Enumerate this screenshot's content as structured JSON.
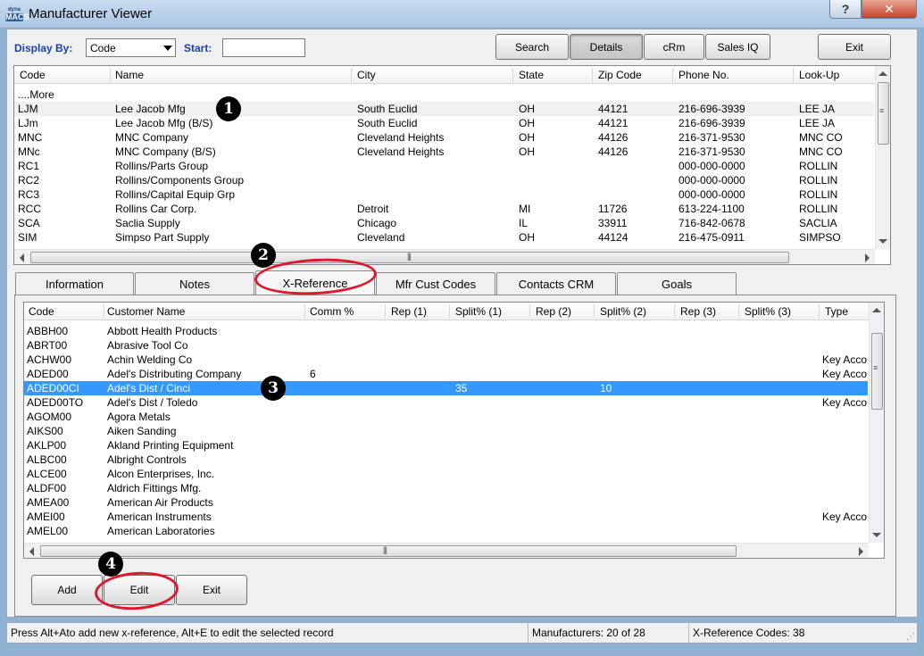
{
  "window": {
    "title": "Manufacturer Viewer",
    "app_logo_top": "dyna",
    "app_logo_main": "MACS",
    "help_glyph": "?",
    "close_glyph": "✕"
  },
  "toolbar": {
    "display_by_label": "Display By:",
    "display_by_value": "Code",
    "start_label": "Start:",
    "start_value": "",
    "search_label": "Search",
    "details_label": "Details",
    "crm_label": "cRm",
    "salesiq_label": "Sales IQ",
    "exit_label": "Exit"
  },
  "manufacturers": {
    "columns": [
      "Code",
      "Name",
      "City",
      "State",
      "Zip Code",
      "Phone No.",
      "Look-Up"
    ],
    "more_label": "....More",
    "rows": [
      [
        "LJM",
        "Lee Jacob Mfg",
        "South Euclid",
        "OH",
        "44121",
        "216-696-3939",
        "LEE JA"
      ],
      [
        "LJm",
        "Lee Jacob Mfg (B/S)",
        "South Euclid",
        "OH",
        "44121",
        "216-696-3939",
        "LEE JA"
      ],
      [
        "MNC",
        "MNC Company",
        "Cleveland Heights",
        "OH",
        "44126",
        "216-371-9530",
        "MNC CO"
      ],
      [
        "MNc",
        "MNC Company (B/S)",
        "Cleveland Heights",
        "OH",
        "44126",
        "216-371-9530",
        "MNC CO"
      ],
      [
        "RC1",
        "Rollins/Parts Group",
        "",
        "",
        "",
        "000-000-0000",
        "ROLLIN"
      ],
      [
        "RC2",
        "Rollins/Components Group",
        "",
        "",
        "",
        "000-000-0000",
        "ROLLIN"
      ],
      [
        "RC3",
        "Rollins/Capital Equip Grp",
        "",
        "",
        "",
        "000-000-0000",
        "ROLLIN"
      ],
      [
        "RCC",
        "Rollins Car Corp.",
        "Detroit",
        "MI",
        "11726",
        "613-224-1100",
        "ROLLIN"
      ],
      [
        "SCA",
        "Saclia Supply",
        "Chicago",
        "IL",
        "33911",
        "716-842-0678",
        "SACLIA"
      ],
      [
        "SIM",
        "Simpso Part Supply",
        "Cleveland",
        "OH",
        "44124",
        "216-475-0911",
        "SIMPSO"
      ]
    ]
  },
  "tabs": [
    "Information",
    "Notes",
    "X-Reference",
    "Mfr Cust Codes",
    "Contacts CRM",
    "Goals"
  ],
  "active_tab": "X-Reference",
  "xref": {
    "columns": [
      "Code",
      "Customer Name",
      "Comm %",
      "Rep (1)",
      "Split% (1)",
      "Rep (2)",
      "Split% (2)",
      "Rep (3)",
      "Split% (3)",
      "Type"
    ],
    "selected_index": 4,
    "rows": [
      [
        "ABBH00",
        "Abbott Health Products",
        "",
        "",
        "",
        "",
        "",
        "",
        "",
        ""
      ],
      [
        "ABRT00",
        "Abrasive Tool Co",
        "",
        "",
        "",
        "",
        "",
        "",
        "",
        ""
      ],
      [
        "ACHW00",
        "Achin Welding Co",
        "",
        "",
        "",
        "",
        "",
        "",
        "",
        "Key Acco"
      ],
      [
        "ADED00",
        "Adel's Distributing Company",
        "6",
        "",
        "",
        "",
        "",
        "",
        "",
        "Key Acco"
      ],
      [
        "ADED00CI",
        "Adel's Dist / Cinci",
        "",
        "",
        "35",
        "",
        "10",
        "",
        "",
        ""
      ],
      [
        "ADED00TO",
        "Adel's Dist / Toledo",
        "",
        "",
        "",
        "",
        "",
        "",
        "",
        "Key Acco"
      ],
      [
        "AGOM00",
        "Agora Metals",
        "",
        "",
        "",
        "",
        "",
        "",
        "",
        ""
      ],
      [
        "AIKS00",
        "Aiken Sanding",
        "",
        "",
        "",
        "",
        "",
        "",
        "",
        ""
      ],
      [
        "AKLP00",
        "Akland Printing Equipment",
        "",
        "",
        "",
        "",
        "",
        "",
        "",
        ""
      ],
      [
        "ALBC00",
        "Albright Controls",
        "",
        "",
        "",
        "",
        "",
        "",
        "",
        ""
      ],
      [
        "ALCE00",
        "Alcon Enterprises, Inc.",
        "",
        "",
        "",
        "",
        "",
        "",
        "",
        ""
      ],
      [
        "ALDF00",
        "Aldrich Fittings Mfg.",
        "",
        "",
        "",
        "",
        "",
        "",
        "",
        ""
      ],
      [
        "AMEA00",
        "American Air Products",
        "",
        "",
        "",
        "",
        "",
        "",
        "",
        ""
      ],
      [
        "AMEI00",
        "American Instruments",
        "",
        "",
        "",
        "",
        "",
        "",
        "",
        "Key Acco"
      ],
      [
        "AMEL00",
        "American Laboratories",
        "",
        "",
        "",
        "",
        "",
        "",
        "",
        ""
      ]
    ]
  },
  "actions": {
    "add_label": "Add",
    "edit_label": "Edit",
    "exit_label": "Exit"
  },
  "callouts": [
    "1",
    "2",
    "3",
    "4"
  ],
  "status": {
    "hint": "Press Alt+Ato add new x-reference,   Alt+E to edit the selected record",
    "manufacturers": "Manufacturers: 20 of 28",
    "xref_count": "X-Reference Codes: 38"
  },
  "colors": {
    "selection": "#3399ff",
    "accent_label": "#1a3fb5",
    "callout_ring": "#e0182d"
  }
}
